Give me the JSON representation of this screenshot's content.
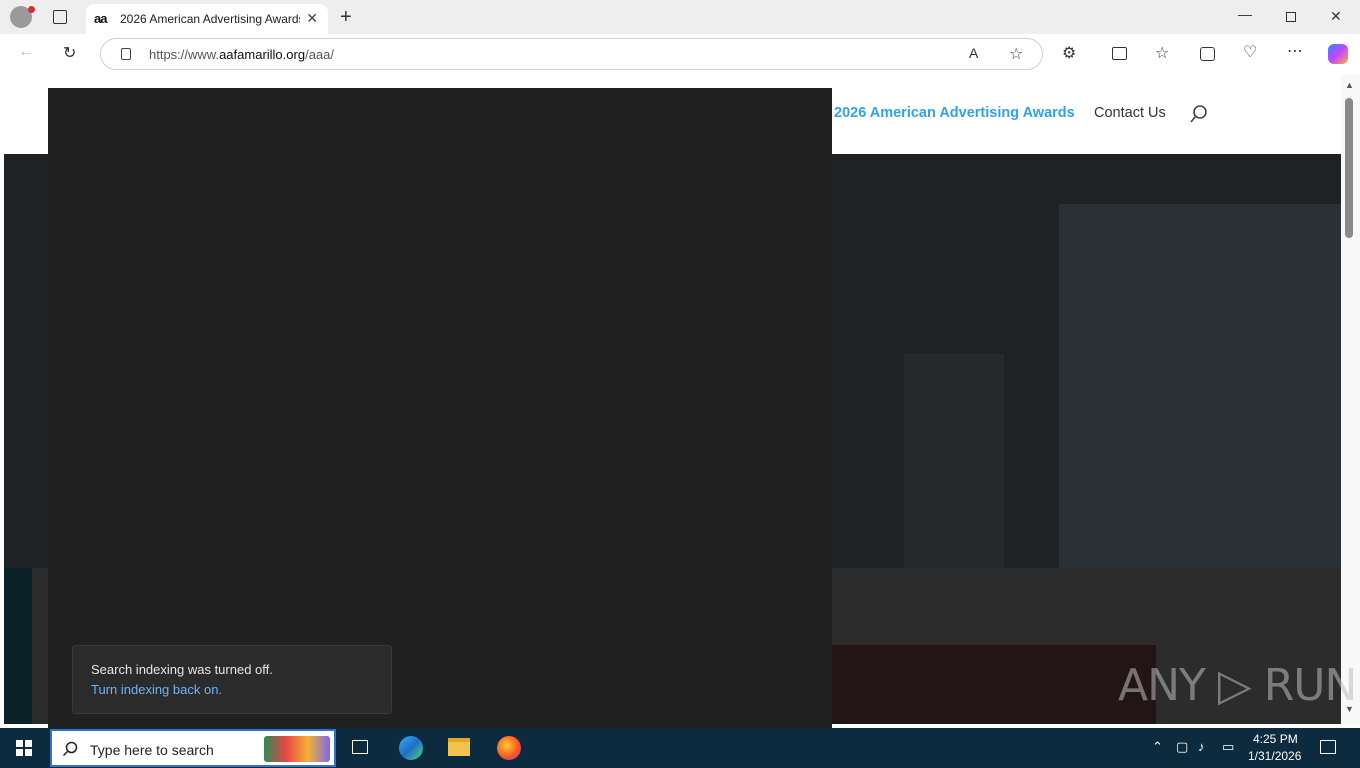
{
  "browser": {
    "tab_title": "2026 American Advertising Awards",
    "favicon_text": "aa",
    "url_prefix": "https://www.",
    "url_domain": "aafamarillo.org",
    "url_path": "/aaa/"
  },
  "site_nav": {
    "awards_label": "2026 American Advertising Awards",
    "contact_label": "Contact Us",
    "accent_color": "#2ea3f2"
  },
  "notification": {
    "message": "Search indexing was turned off.",
    "link": "Turn indexing back on."
  },
  "watermark": "ANY ▷ RUN",
  "taskbar": {
    "search_placeholder": "Type here to search",
    "time": "4:25 PM",
    "date": "1/31/2026"
  }
}
